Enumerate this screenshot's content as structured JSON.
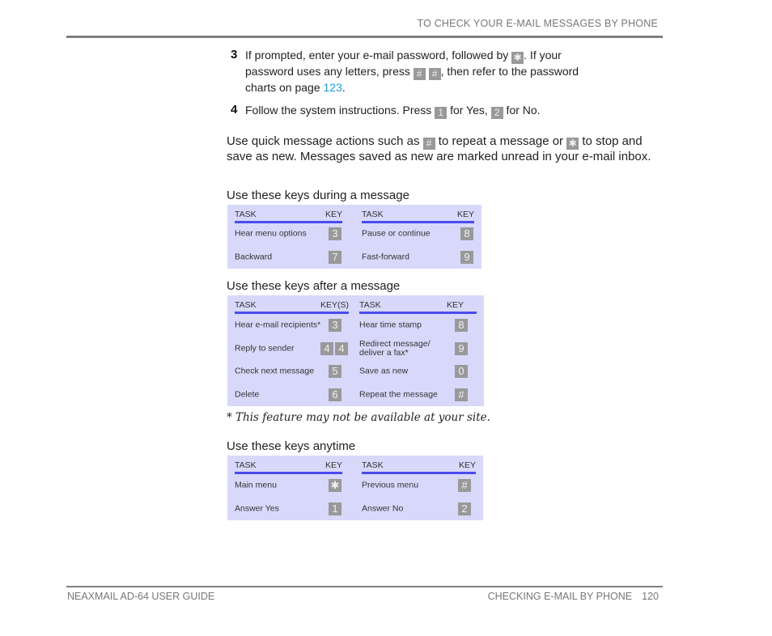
{
  "header": {
    "running_head": "TO CHECK YOUR E-MAIL MESSAGES BY PHONE"
  },
  "steps": [
    {
      "number": "3",
      "parts": [
        "If prompted, enter your e-mail password, followed by ",
        ". If your password uses any letters, press ",
        " ",
        ", then refer to the password charts on page ",
        "."
      ],
      "keys": [
        "✱",
        "#",
        "#"
      ],
      "link": "123"
    },
    {
      "number": "4",
      "parts": [
        "Follow the system instructions. Press ",
        " for Yes, ",
        " for No."
      ],
      "keys": [
        "1",
        "2"
      ]
    }
  ],
  "intro": {
    "parts": [
      "Use quick message actions such as ",
      " to repeat a message or ",
      " to stop and save as new. Messages saved as new are marked unread in your e-mail inbox."
    ],
    "keys": [
      "#",
      "✱"
    ]
  },
  "tables": [
    {
      "title": "Use these keys during a message",
      "left": {
        "task_header": "TASK",
        "key_header": "KEY",
        "rows": [
          {
            "task": "Hear menu options",
            "keys": [
              "3"
            ]
          },
          {
            "task": "Backward",
            "keys": [
              "7"
            ]
          }
        ]
      },
      "right": {
        "task_header": "TASK",
        "key_header": "KEY",
        "rows": [
          {
            "task": "Pause or continue",
            "keys": [
              "8"
            ]
          },
          {
            "task": "Fast-forward",
            "keys": [
              "9"
            ]
          }
        ]
      }
    },
    {
      "title": "Use these keys after a message",
      "left": {
        "task_header": "TASK",
        "key_header": "KEY(S)",
        "rows": [
          {
            "task": "Hear e-mail recipients*",
            "keys": [
              "3"
            ]
          },
          {
            "task": "Reply to sender",
            "keys": [
              "4",
              "4"
            ]
          },
          {
            "task": "Check next message",
            "keys": [
              "5"
            ]
          },
          {
            "task": "Delete",
            "keys": [
              "6"
            ]
          }
        ]
      },
      "right": {
        "task_header": "TASK",
        "key_header": "KEY",
        "rows": [
          {
            "task": "Hear time stamp",
            "keys": [
              "8"
            ]
          },
          {
            "task": "Redirect message/ deliver a fax*",
            "task_line1": "Redirect message/",
            "task_line2": "deliver a fax*",
            "keys": [
              "9"
            ]
          },
          {
            "task": "Save as new",
            "keys": [
              "0"
            ]
          },
          {
            "task": "Repeat the message",
            "keys": [
              "#"
            ]
          }
        ]
      }
    },
    {
      "title": "Use these keys anytime",
      "left": {
        "task_header": "TASK",
        "key_header": "KEY",
        "rows": [
          {
            "task": "Main menu",
            "keys": [
              "✱"
            ]
          },
          {
            "task": "Answer Yes",
            "keys": [
              "1"
            ]
          }
        ]
      },
      "right": {
        "task_header": "TASK",
        "key_header": "KEY",
        "rows": [
          {
            "task": "Previous menu",
            "keys": [
              "#"
            ]
          },
          {
            "task": "Answer No",
            "keys": [
              "2"
            ]
          }
        ]
      }
    }
  ],
  "footnote": "* This feature may not be available at your site.",
  "footer": {
    "left": "NEAXMAIL AD-64 USER GUIDE",
    "section": "CHECKING E-MAIL BY PHONE",
    "page": "120"
  }
}
